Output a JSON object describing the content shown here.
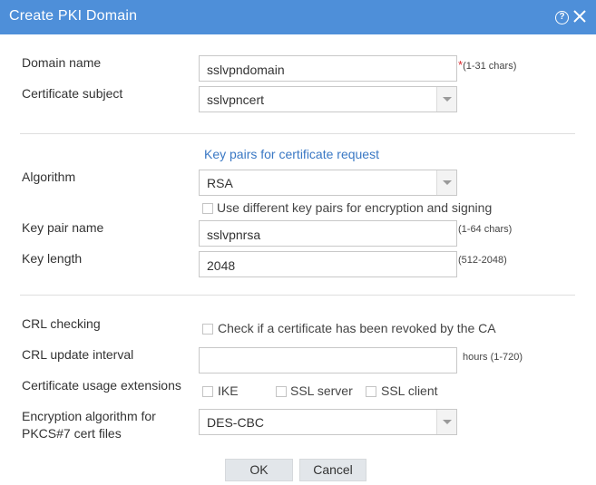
{
  "dialog": {
    "title": "Create PKI Domain",
    "accent_color": "#4e8fd9"
  },
  "icons": {
    "help": "help-icon",
    "close": "close-icon"
  },
  "form": {
    "domain_name": {
      "label": "Domain name",
      "value": "sslvpndomain",
      "required_mark": "*",
      "hint": "(1-31 chars)"
    },
    "certificate_subject": {
      "label": "Certificate subject",
      "value": "sslvpncert"
    },
    "key_pairs_section": "Key pairs for certificate request",
    "algorithm": {
      "label": "Algorithm",
      "value": "RSA"
    },
    "different_key_pairs": {
      "label": "Use different key pairs for encryption and signing",
      "checked": false
    },
    "key_pair_name": {
      "label": "Key pair name",
      "value": "sslvpnrsa",
      "hint": "(1-64 chars)"
    },
    "key_length": {
      "label": "Key length",
      "value": "2048",
      "hint": "(512-2048)"
    },
    "crl_checking": {
      "label": "CRL checking",
      "option": "Check if a certificate has been revoked by the CA",
      "checked": false
    },
    "crl_update_interval": {
      "label": "CRL update interval",
      "value": "",
      "hint": "hours (1-720)"
    },
    "usage_extensions": {
      "label": "Certificate usage extensions",
      "options": [
        {
          "label": "IKE",
          "checked": false
        },
        {
          "label": "SSL server",
          "checked": false
        },
        {
          "label": "SSL client",
          "checked": false
        }
      ]
    },
    "encryption_algorithm": {
      "label_line1": "Encryption algorithm for",
      "label_line2": "PKCS#7 cert files",
      "value": "DES-CBC"
    }
  },
  "buttons": {
    "ok": "OK",
    "cancel": "Cancel"
  }
}
